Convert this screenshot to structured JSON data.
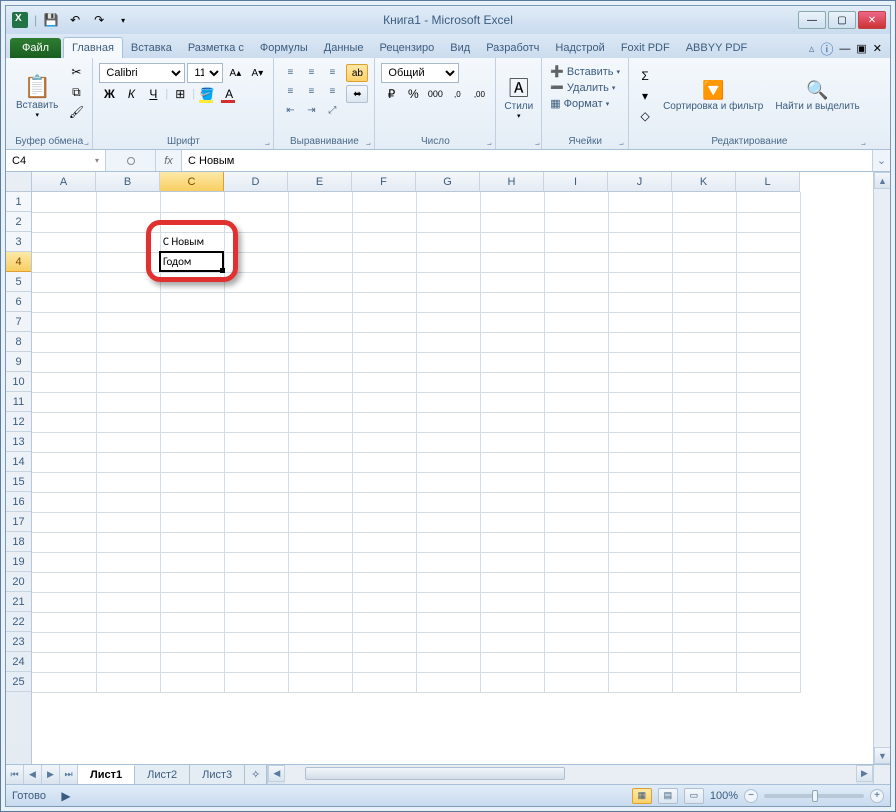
{
  "title": "Книга1  -  Microsoft Excel",
  "qat": {
    "save": "💾",
    "undo": "↶",
    "redo": "↷"
  },
  "tabs": {
    "file": "Файл",
    "items": [
      "Главная",
      "Вставка",
      "Разметка с",
      "Формулы",
      "Данные",
      "Рецензиро",
      "Вид",
      "Разработч",
      "Надстрой",
      "Foxit PDF",
      "ABBYY PDF"
    ],
    "active": 0
  },
  "ribbon": {
    "clipboard": {
      "paste": "Вставить",
      "label": "Буфер обмена"
    },
    "font": {
      "name": "Calibri",
      "size": "11",
      "label": "Шрифт",
      "bold": "Ж",
      "italic": "К",
      "underline": "Ч"
    },
    "align": {
      "label": "Выравнивание"
    },
    "number": {
      "format": "Общий",
      "label": "Число"
    },
    "styles": {
      "btn": "Стили",
      "label": ""
    },
    "cells": {
      "insert": "Вставить",
      "delete": "Удалить",
      "format": "Формат",
      "label": "Ячейки"
    },
    "editing": {
      "sort": "Сортировка и фильтр",
      "find": "Найти и выделить",
      "label": "Редактирование"
    }
  },
  "formula_bar": {
    "name_box": "C4",
    "fx": "fx",
    "value": "С Новым"
  },
  "grid": {
    "cols": [
      "A",
      "B",
      "C",
      "D",
      "E",
      "F",
      "G",
      "H",
      "I",
      "J",
      "K",
      "L"
    ],
    "rows": 25,
    "active_col": 2,
    "active_row": 3,
    "cells": {
      "C3": "С Новым",
      "C4": "Годом"
    },
    "selection": {
      "col": 2,
      "row": 3
    }
  },
  "sheets": {
    "items": [
      "Лист1",
      "Лист2",
      "Лист3"
    ],
    "active": 0
  },
  "status": {
    "ready": "Готово",
    "zoom": "100%"
  }
}
